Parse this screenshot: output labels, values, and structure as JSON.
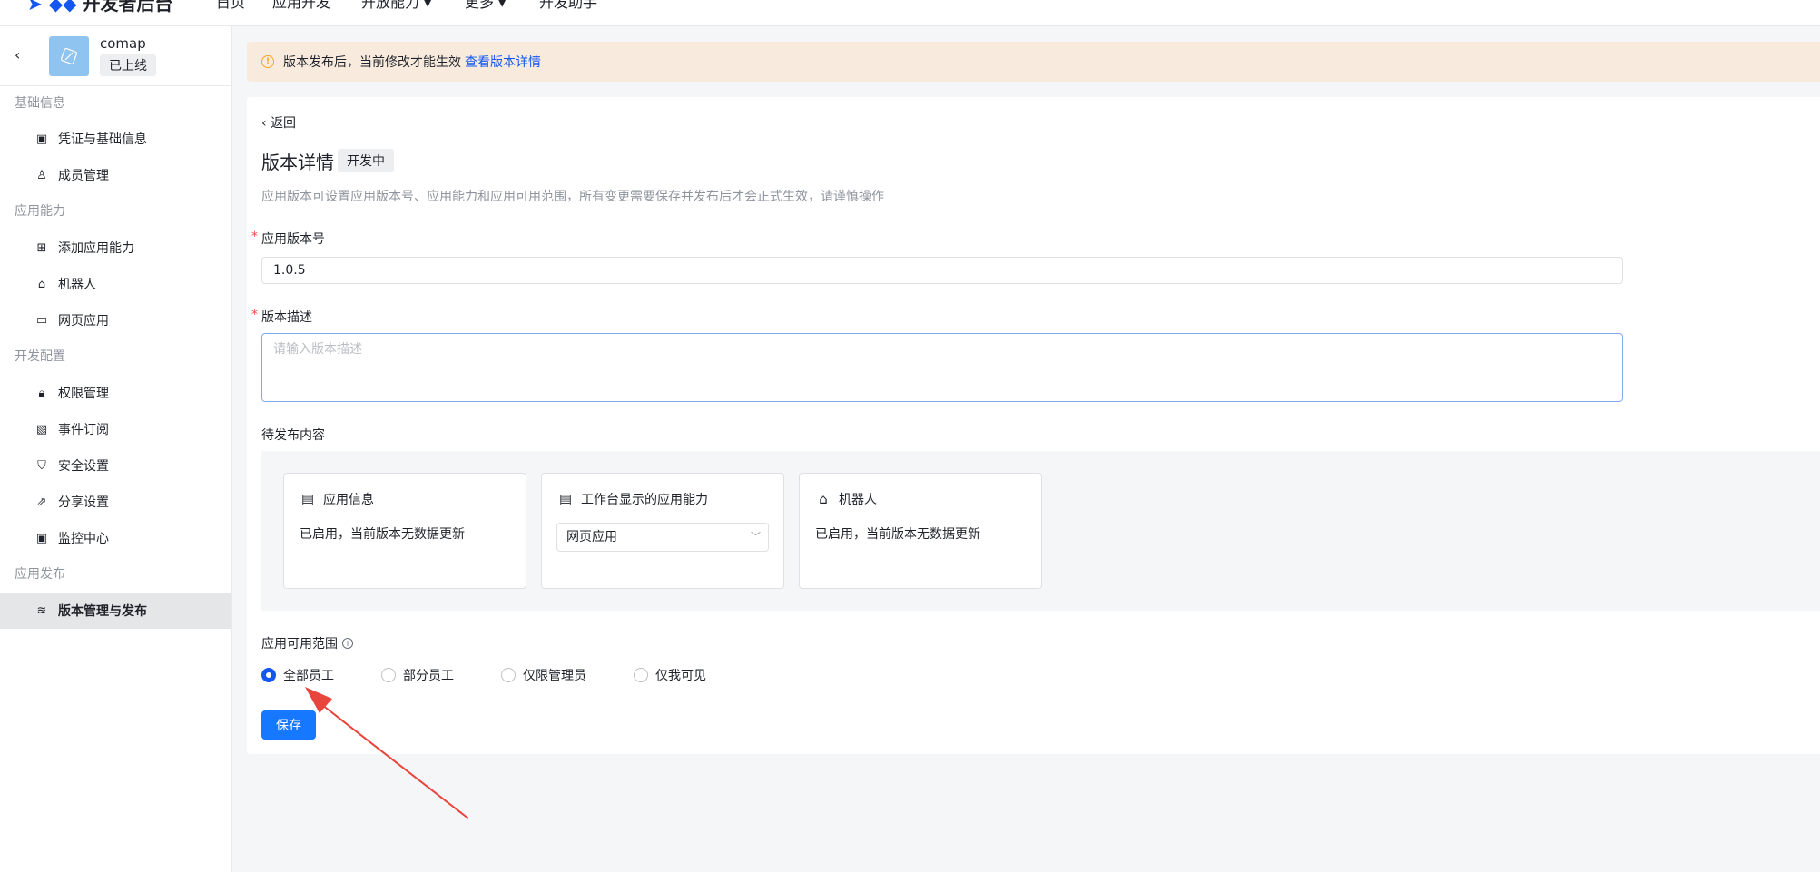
{
  "topnav": {
    "brand_name": "开发者后台",
    "items": [
      "首页",
      "应用开发",
      "开放能力 ▾",
      "更多 ▾",
      "开发助手"
    ]
  },
  "sidebar": {
    "app_name": "comap",
    "app_status": "已上线",
    "sections": [
      {
        "title": "基础信息",
        "items": [
          {
            "label": "凭证与基础信息",
            "icon": "credential-icon"
          },
          {
            "label": "成员管理",
            "icon": "member-icon"
          }
        ]
      },
      {
        "title": "应用能力",
        "items": [
          {
            "label": "添加应用能力",
            "icon": "add-capability-icon"
          },
          {
            "label": "机器人",
            "icon": "robot-icon"
          },
          {
            "label": "网页应用",
            "icon": "webpage-icon"
          }
        ]
      },
      {
        "title": "开发配置",
        "items": [
          {
            "label": "权限管理",
            "icon": "lock-icon"
          },
          {
            "label": "事件订阅",
            "icon": "event-icon"
          },
          {
            "label": "安全设置",
            "icon": "shield-icon"
          },
          {
            "label": "分享设置",
            "icon": "share-icon"
          },
          {
            "label": "监控中心",
            "icon": "monitor-icon"
          }
        ]
      },
      {
        "title": "应用发布",
        "items": [
          {
            "label": "版本管理与发布",
            "icon": "layers-icon",
            "active": true
          }
        ]
      }
    ]
  },
  "notice": {
    "text": "版本发布后，当前修改才能生效",
    "link": "查看版本详情"
  },
  "detail": {
    "back_label": "返回",
    "title": "版本详情",
    "badge": "开发中",
    "description": "应用版本可设置应用版本号、应用能力和应用可用范围，所有变更需要保存并发布后才会正式生效，请谨慎操作",
    "version_label": "应用版本号",
    "version_value": "1.0.5",
    "desc_label": "版本描述",
    "desc_placeholder": "请输入版本描述",
    "pending_label": "待发布内容",
    "pending_cards": [
      {
        "title": "应用信息",
        "icon": "app-info-icon",
        "text": "已启用，当前版本无数据更新"
      },
      {
        "title": "工作台显示的应用能力",
        "icon": "workbench-icon",
        "select_value": "网页应用"
      },
      {
        "title": "机器人",
        "icon": "robot-icon",
        "text": "已启用，当前版本无数据更新"
      }
    ],
    "scope_label": "应用可用范围",
    "scope_options": [
      {
        "label": "全部员工",
        "checked": true
      },
      {
        "label": "部分员工",
        "checked": false
      },
      {
        "label": "仅限管理员",
        "checked": false
      },
      {
        "label": "仅我可见",
        "checked": false
      }
    ],
    "save_label": "保存"
  },
  "colors": {
    "primary": "#1456f0",
    "button": "#1677ff",
    "notice_bg": "#f8ebde",
    "annotation_arrow": "#e8453c"
  }
}
